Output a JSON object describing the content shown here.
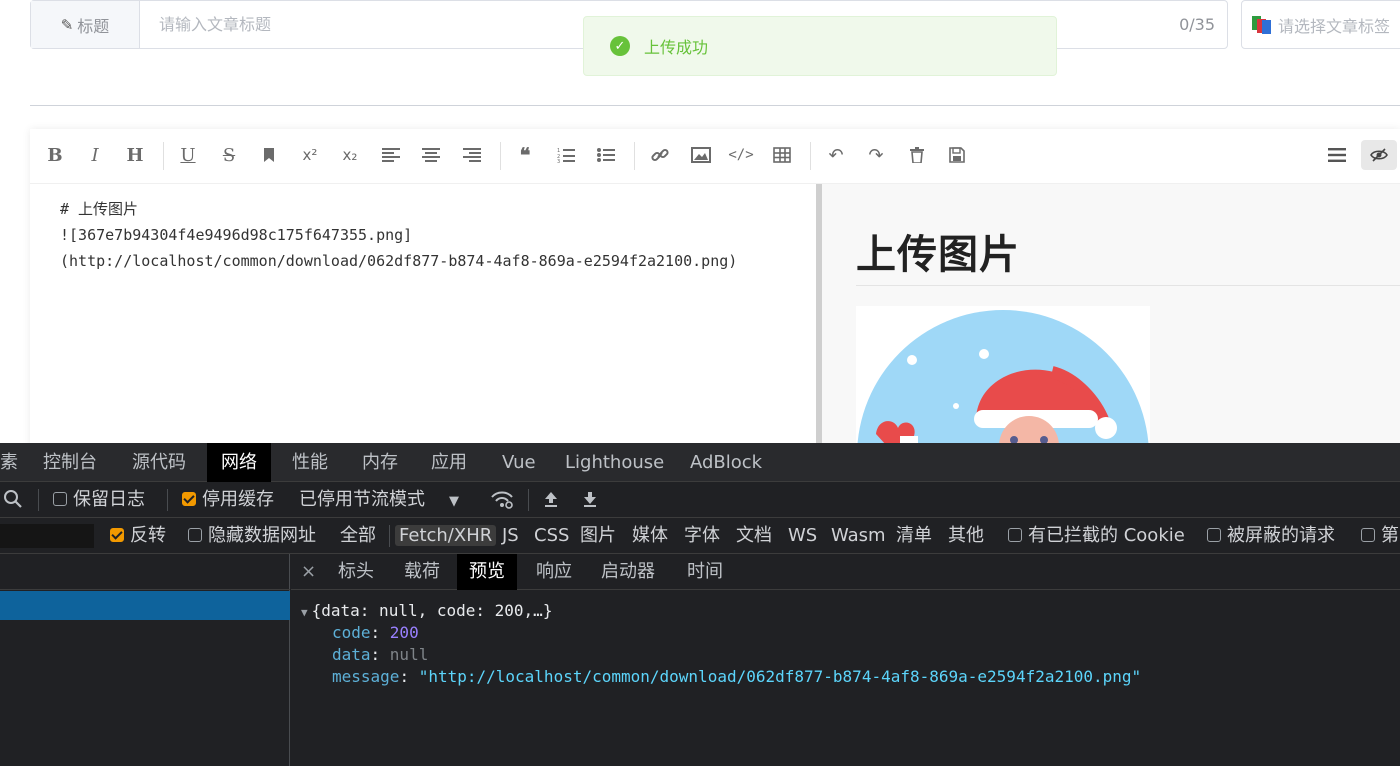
{
  "editor_header": {
    "title_label": "标题",
    "title_placeholder": "请输入文章标题",
    "title_counter": "0/35",
    "tag_placeholder": "请选择文章标签"
  },
  "toast": {
    "message": "上传成功",
    "type": "success"
  },
  "toolbar": {
    "buttons": [
      "bold",
      "italic",
      "header",
      "underline",
      "strikethrough",
      "mark",
      "superscript",
      "subscript",
      "align-left",
      "align-center",
      "align-right",
      "quote",
      "ordered-list",
      "unordered-list",
      "link",
      "image",
      "code",
      "table",
      "undo",
      "redo",
      "trash",
      "save",
      "navigation",
      "preview-toggle"
    ]
  },
  "markdown": {
    "line1": "# 上传图片",
    "line2": "![367e7b94304f4e9496d98c175f647355.png]",
    "line3": "(http://localhost/common/download/062df877-b874-4af8-869a-e2594f2a2100.png)"
  },
  "preview": {
    "heading": "上传图片"
  },
  "devtools": {
    "main_tabs": [
      "素",
      "控制台",
      "源代码",
      "网络",
      "性能",
      "内存",
      "应用",
      "Vue",
      "Lighthouse",
      "AdBlock"
    ],
    "active_tab": "网络",
    "preserve_log_label": "保留日志",
    "disable_cache_label": "停用缓存",
    "throttle_label": "已停用节流模式",
    "invert_label": "反转",
    "hide_data_urls_label": "隐藏数据网址",
    "filter_types": [
      "全部",
      "Fetch/XHR",
      "JS",
      "CSS",
      "图片",
      "媒体",
      "字体",
      "文档",
      "WS",
      "Wasm",
      "清单",
      "其他"
    ],
    "active_filter": "Fetch/XHR",
    "blocked_cookies_label": "有已拦截的 Cookie",
    "blocked_requests_label": "被屏蔽的请求",
    "third_party_label": "第",
    "detail_tabs": [
      "标头",
      "载荷",
      "预览",
      "响应",
      "启动器",
      "时间"
    ],
    "active_detail_tab": "预览",
    "close_glyph": "×",
    "preview_json": {
      "summary": "{data: null, code: 200,…}",
      "code_key": "code",
      "code_value": "200",
      "data_key": "data",
      "data_value": "null",
      "message_key": "message",
      "message_value": "\"http://localhost/common/download/062df877-b874-4af8-869a-e2594f2a2100.png\""
    }
  },
  "colors": {
    "success": "#67c23a",
    "devtools_bg": "#202124",
    "accent_checkbox": "#f29900",
    "selected_row": "#0e639c"
  }
}
